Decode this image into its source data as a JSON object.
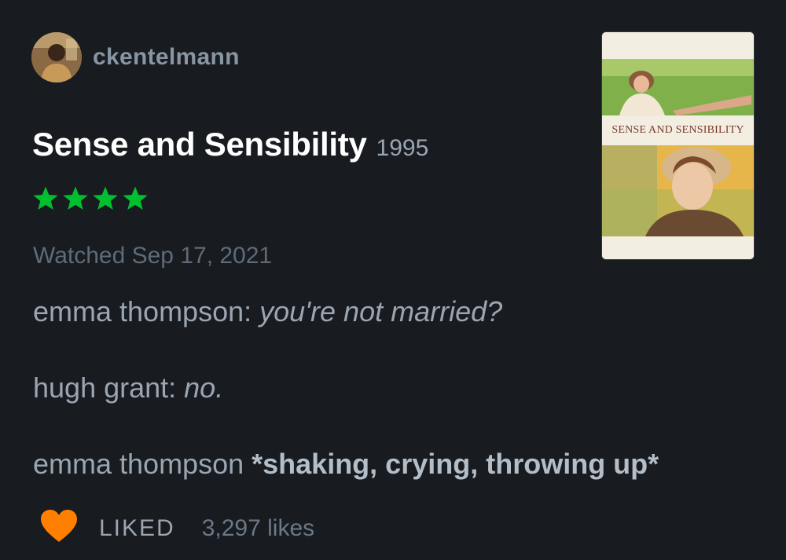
{
  "review": {
    "username": "ckentelmann",
    "film_title": "Sense and Sensibility",
    "film_year": "1995",
    "rating_stars": 4,
    "watched_label": "Watched Sep 17, 2021",
    "lines": [
      {
        "prefix": "emma thompson: ",
        "emphasis": "you're not married?"
      },
      {
        "prefix": "hugh grant: ",
        "emphasis": "no."
      },
      {
        "prefix": "emma thompson ",
        "strong": "*shaking, crying, throwing up*"
      }
    ],
    "liked_label": "LIKED",
    "likes_count": "3,297 likes"
  },
  "poster": {
    "title_text": "SENSE AND SENSIBILITY"
  },
  "colors": {
    "background": "#181b20",
    "star_green": "#00c030",
    "heart_orange": "#ff8000"
  },
  "icons": {
    "rating": "star-icon",
    "like": "heart-icon"
  }
}
